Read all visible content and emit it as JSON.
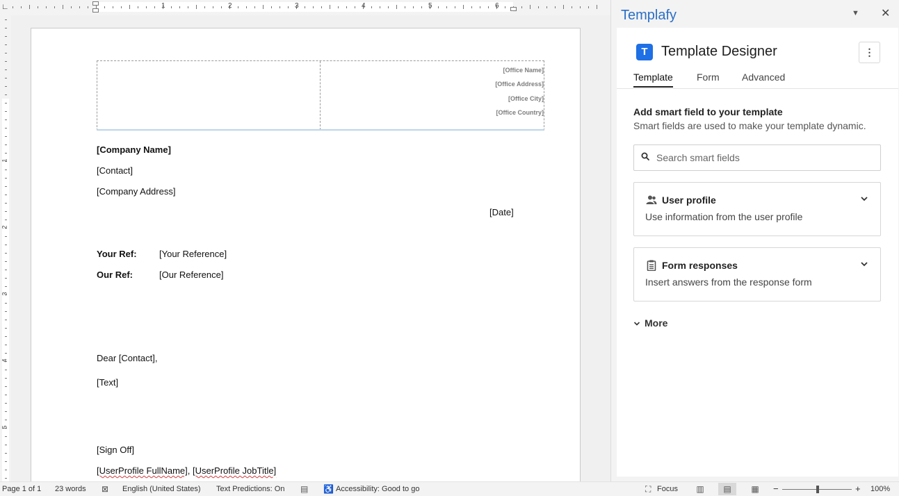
{
  "document": {
    "office": {
      "name": "[Office Name]",
      "address": "[Office Address]",
      "city": "[Office City]",
      "country": "[Office Country]"
    },
    "company_name": "[Company Name]",
    "contact": "[Contact]",
    "company_address": "[Company Address]",
    "date": "[Date]",
    "your_ref_label": "Your Ref:",
    "your_ref_value": "[Your Reference]",
    "our_ref_label": "Our Ref:",
    "our_ref_value": "[Our Reference]",
    "salutation": "Dear [Contact],",
    "body": "[Text]",
    "sign_off": "[Sign Off]",
    "signature": {
      "fullname": "[UserProfile FullName]",
      "separator": ", ",
      "jobtitle": "[UserProfile JobTitle]"
    }
  },
  "ruler": {
    "numbers": [
      "1",
      "2",
      "3",
      "4",
      "5",
      "6"
    ],
    "vertical_numbers": [
      "1",
      "2",
      "3",
      "4",
      "5"
    ]
  },
  "statusbar": {
    "page": "Page 1 of 1",
    "words": "23 words",
    "language": "English (United States)",
    "text_predictions": "Text Predictions: On",
    "accessibility": "Accessibility: Good to go",
    "focus": "Focus",
    "zoom_percent": "100%",
    "zoom_level": 1.0
  },
  "pane": {
    "title": "Templafy",
    "app_logo_letter": "T",
    "app_title": "Template Designer",
    "tabs": [
      {
        "label": "Template",
        "active": true
      },
      {
        "label": "Form",
        "active": false
      },
      {
        "label": "Advanced",
        "active": false
      }
    ],
    "section_title": "Add smart field to your template",
    "section_subtitle": "Smart fields are used to make your template dynamic.",
    "search_placeholder": "Search smart fields",
    "cards": [
      {
        "title": "User profile",
        "description": "Use information from the user profile",
        "icon": "users-icon"
      },
      {
        "title": "Form responses",
        "description": "Insert answers from the response form",
        "icon": "clipboard-icon"
      }
    ],
    "more_label": "More"
  },
  "colors": {
    "accent": "#2b6fc7",
    "logo": "#1f6fe5",
    "spellcheck": "#d23b3b"
  }
}
